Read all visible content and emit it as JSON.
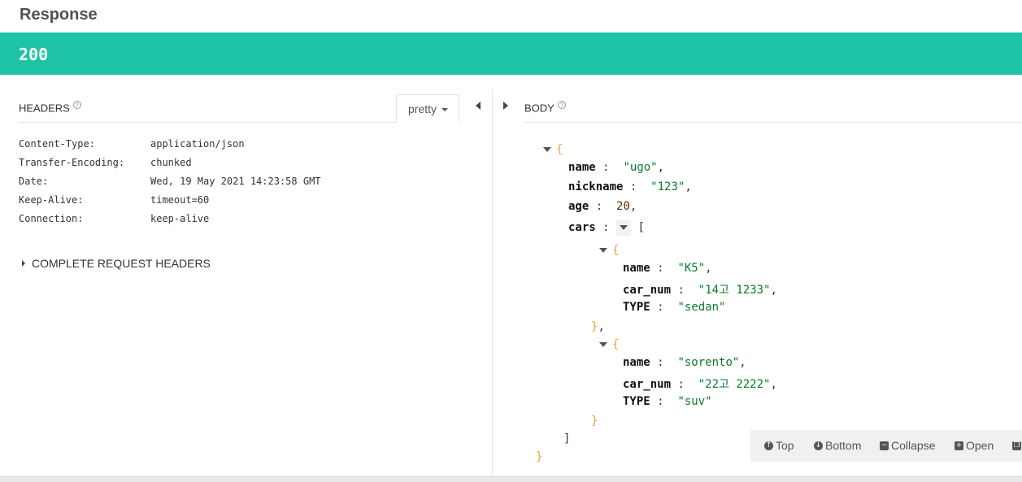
{
  "title": "Response",
  "status_code": "200",
  "headers": {
    "title": "HEADERS",
    "help": "?",
    "format": "pretty",
    "rows": [
      {
        "key": "Content-Type:",
        "value": "application/json"
      },
      {
        "key": "Transfer-Encoding:",
        "value": "chunked"
      },
      {
        "key": "Date:",
        "value": "Wed, 19 May 2021 14:23:58 GMT"
      },
      {
        "key": "Keep-Alive:",
        "value": "timeout=60"
      },
      {
        "key": "Connection:",
        "value": "keep-alive"
      }
    ],
    "complete_request": "COMPLETE REQUEST HEADERS"
  },
  "body": {
    "title": "BODY",
    "help": "?",
    "json": {
      "name": "\"ugo\"",
      "nickname": "\"123\"",
      "age": "20",
      "cars": [
        {
          "name": "\"K5\"",
          "car_num": "\"14고 1233\"",
          "TYPE": "\"sedan\""
        },
        {
          "name": "\"sorento\"",
          "car_num": "\"22고 2222\"",
          "TYPE": "\"suv\""
        }
      ]
    },
    "keys": {
      "name": "name",
      "nickname": "nickname",
      "age": "age",
      "cars": "cars",
      "car_num": "car_num",
      "type": "TYPE"
    }
  },
  "toolbar": {
    "top": "Top",
    "bottom": "Bottom",
    "collapse": "Collapse",
    "open": "Open"
  },
  "icons": [
    "help-icon",
    "caret-down-icon",
    "collapse-left-icon",
    "expand-right-icon",
    "arrow-up-icon",
    "arrow-down-icon",
    "minus-icon",
    "plus-icon",
    "copy-icon"
  ]
}
